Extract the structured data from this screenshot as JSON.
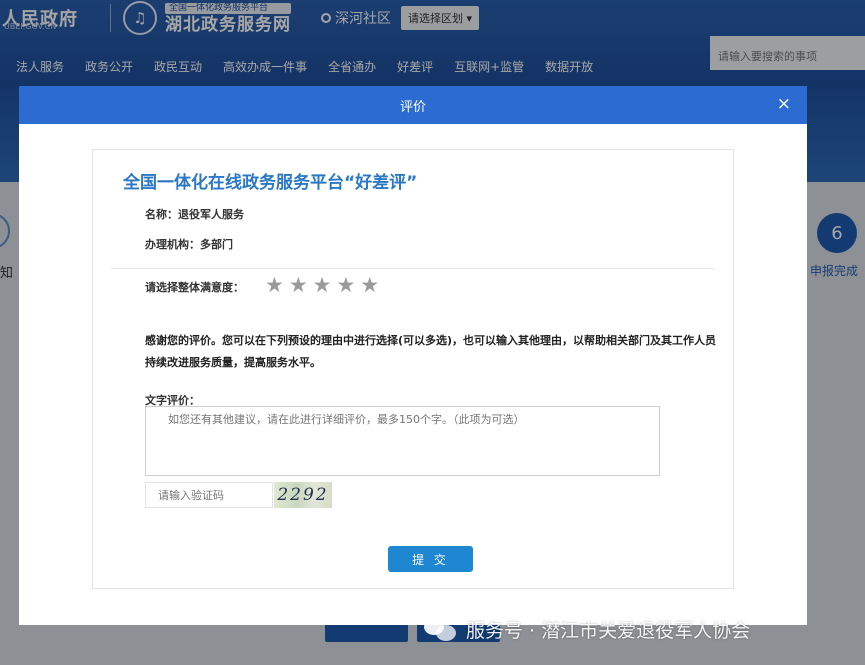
{
  "background": {
    "gov_title": "人民政府",
    "gov_url": "UBEI.GOV.CN",
    "brand_top": "全国一体化政务服务平台",
    "brand_main": "湖北政务服务网",
    "location": "深河社区",
    "region_button": "请选择区划 ▾",
    "search_placeholder": "请输入要搜索的事项",
    "nav": [
      "法人服务",
      "政务公开",
      "政民互动",
      "高效办成一件事",
      "全省通办",
      "好差评",
      "互联网+监管",
      "数据开放"
    ],
    "step_number": "6",
    "step_label": "申报完成",
    "left_partial": "知"
  },
  "modal": {
    "title": "评价",
    "close": "×",
    "card_title": "全国一体化在线政务服务平台“好差评”",
    "name_label": "名称：退役军人服务",
    "org_label": "办理机构：多部门",
    "rating_label": "请选择整体满意度：",
    "stars": 5,
    "rating_value": 0,
    "description": "感谢您的评价。您可以在下列预设的理由中进行选择(可以多选)，也可以输入其他理由，以帮助相关部门及其工作人员持续改进服务质量，提高服务水平。",
    "text_label": "文字评价：",
    "text_placeholder": "如您还有其他建议，请在此进行详细评价，最多150个字。（此项为可选）",
    "captcha_placeholder": "请输入验证码",
    "captcha_text": "2292",
    "submit": "提 交"
  },
  "watermark": {
    "text": "服务号 · 潜江市关爱退役军人协会"
  }
}
